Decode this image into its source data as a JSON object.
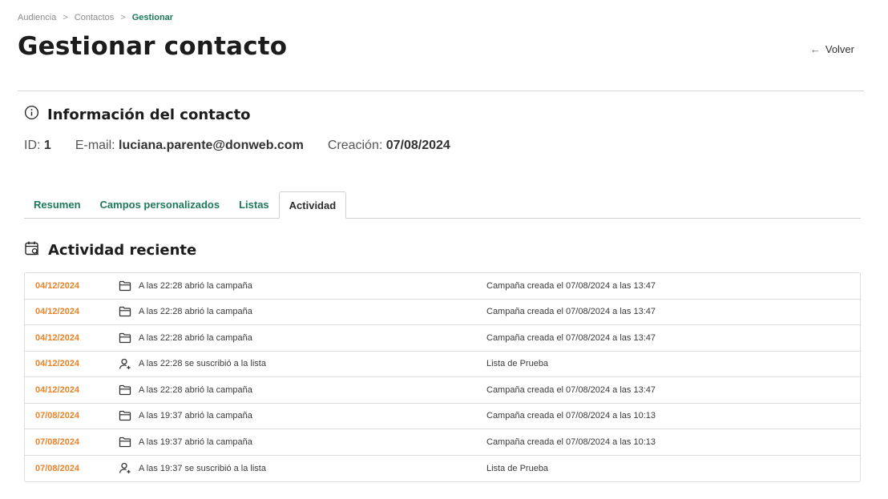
{
  "breadcrumb": {
    "items": [
      "Audiencia",
      "Contactos"
    ],
    "current": "Gestionar",
    "separator": ">"
  },
  "page": {
    "title": "Gestionar contacto",
    "back_label": "Volver"
  },
  "contact_info": {
    "title": "Información del contacto",
    "id_label": "ID:",
    "id_value": "1",
    "email_label": "E-mail:",
    "email_value": "luciana.parente@donweb.com",
    "created_label": "Creación:",
    "created_value": "07/08/2024"
  },
  "tabs": [
    {
      "label": "Resumen",
      "active": false
    },
    {
      "label": "Campos personalizados",
      "active": false
    },
    {
      "label": "Listas",
      "active": false
    },
    {
      "label": "Actividad",
      "active": true
    }
  ],
  "activity": {
    "title": "Actividad reciente",
    "rows": [
      {
        "date": "04/12/2024",
        "icon": "folder-icon",
        "description": "A las 22:28 abrió la campaña",
        "detail": "Campaña creada el 07/08/2024 a las 13:47"
      },
      {
        "date": "04/12/2024",
        "icon": "folder-icon",
        "description": "A las 22:28 abrió la campaña",
        "detail": "Campaña creada el 07/08/2024 a las 13:47"
      },
      {
        "date": "04/12/2024",
        "icon": "folder-icon",
        "description": "A las 22:28 abrió la campaña",
        "detail": "Campaña creada el 07/08/2024 a las 13:47"
      },
      {
        "date": "04/12/2024",
        "icon": "user-add-icon",
        "description": "A las 22:28 se suscribió a la lista",
        "detail": "Lista de Prueba"
      },
      {
        "date": "04/12/2024",
        "icon": "folder-icon",
        "description": "A las 22:28 abrió la campaña",
        "detail": "Campaña creada el 07/08/2024 a las 13:47"
      },
      {
        "date": "07/08/2024",
        "icon": "folder-icon",
        "description": "A las 19:37 abrió la campaña",
        "detail": "Campaña creada el 07/08/2024 a las 10:13"
      },
      {
        "date": "07/08/2024",
        "icon": "folder-icon",
        "description": "A las 19:37 abrió la campaña",
        "detail": "Campaña creada el 07/08/2024 a las 10:13"
      },
      {
        "date": "07/08/2024",
        "icon": "user-add-icon",
        "description": "A las 19:37 se suscribió a la lista",
        "detail": "Lista de Prueba"
      }
    ]
  },
  "colors": {
    "accent_green": "#1d7a58",
    "date_orange": "#e8832a",
    "border": "#dcdcdc"
  }
}
